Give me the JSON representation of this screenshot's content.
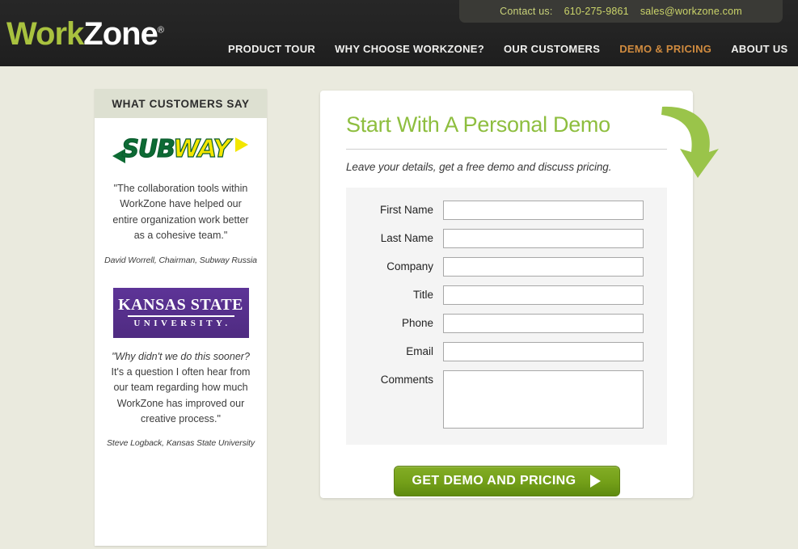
{
  "header": {
    "contact": {
      "label": "Contact us:",
      "phone": "610-275-9861",
      "email": "sales@workzone.com"
    },
    "logo": {
      "part1": "Work",
      "part2": "Zone",
      "registered": "®"
    },
    "nav": [
      {
        "label": "PRODUCT TOUR",
        "active": false
      },
      {
        "label": "WHY CHOOSE WORKZONE?",
        "active": false
      },
      {
        "label": "OUR CUSTOMERS",
        "active": false
      },
      {
        "label": "DEMO & PRICING",
        "active": true
      },
      {
        "label": "ABOUT US",
        "active": false
      }
    ],
    "accent_color": "#d08b3f",
    "logo_green": "#a9c23f"
  },
  "sidebar": {
    "title": "WHAT CUSTOMERS SAY",
    "testimonials": [
      {
        "logo_name": "subway-logo",
        "logo_text_part1": "SUB",
        "logo_text_part2": "WAY",
        "quote": "\"The collaboration tools within WorkZone have helped our entire organization work better as a cohesive team.\"",
        "attribution": "David Worrell, Chairman, Subway Russia"
      },
      {
        "logo_name": "kansas-state-university-logo",
        "logo_line1": "KANSAS STATE",
        "logo_line2": "UNIVERSITY.",
        "quote_italic": "\"Why didn't we do this sooner?",
        "quote_rest": " It's a question I often hear from our team regarding how much WorkZone has improved our creative process.\"",
        "attribution": "Steve Logback, Kansas State University"
      }
    ]
  },
  "main": {
    "title": "Start With A Personal Demo",
    "subtitle": "Leave your details, get a free demo and discuss pricing.",
    "form": {
      "fields": [
        {
          "label": "First Name",
          "value": "",
          "placeholder": "",
          "type": "text",
          "name": "first-name"
        },
        {
          "label": "Last Name",
          "value": "",
          "placeholder": "",
          "type": "text",
          "name": "last-name"
        },
        {
          "label": "Company",
          "value": "",
          "placeholder": "",
          "type": "text",
          "name": "company"
        },
        {
          "label": "Title",
          "value": "",
          "placeholder": "",
          "type": "text",
          "name": "title"
        },
        {
          "label": "Phone",
          "value": "",
          "placeholder": "",
          "type": "text",
          "name": "phone"
        },
        {
          "label": "Email",
          "value": "",
          "placeholder": "",
          "type": "text",
          "name": "email"
        },
        {
          "label": "Comments",
          "value": "",
          "placeholder": "",
          "type": "textarea",
          "name": "comments"
        }
      ],
      "submit_label": "GET DEMO AND PRICING"
    },
    "title_color": "#8ebe3f",
    "button_color": "#74a019"
  }
}
